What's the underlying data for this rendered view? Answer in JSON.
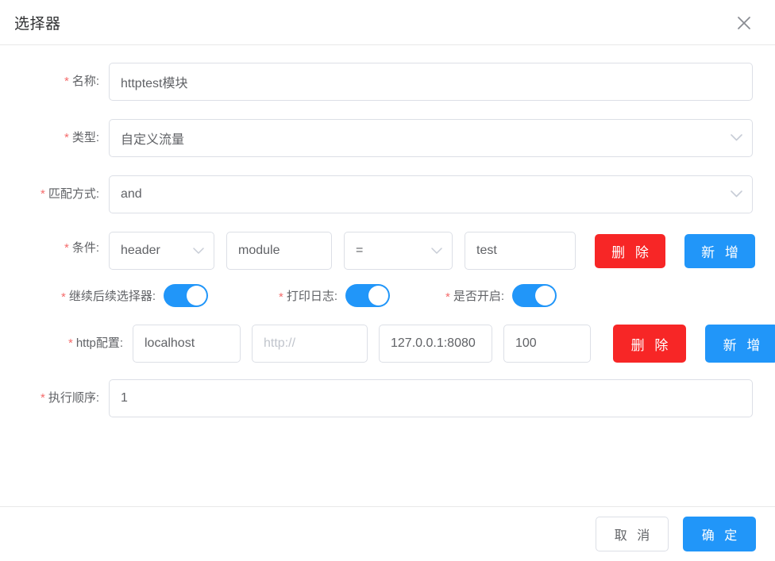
{
  "dialog": {
    "title": "选择器",
    "close_icon": "close-icon"
  },
  "form": {
    "name": {
      "label": "名称:",
      "required_marker": "*",
      "value": "httptest模块"
    },
    "type": {
      "label": "类型:",
      "required_marker": "*",
      "value": "自定义流量",
      "chevron_icon": "chevron-down-icon"
    },
    "match_mode": {
      "label": "匹配方式:",
      "required_marker": "*",
      "value": "and",
      "chevron_icon": "chevron-down-icon"
    },
    "condition": {
      "label": "条件:",
      "required_marker": "*",
      "field_source": "header",
      "field_key": "module",
      "operator": "=",
      "field_value": "test",
      "delete_label": "删 除",
      "add_label": "新 增"
    },
    "switches": [
      {
        "label": "继续后续选择器:",
        "required_marker": "*",
        "state": "on"
      },
      {
        "label": "打印日志:",
        "required_marker": "*",
        "state": "on"
      },
      {
        "label": "是否开启:",
        "required_marker": "*",
        "state": "on"
      }
    ],
    "http_config": {
      "label": "http配置:",
      "required_marker": "*",
      "host": "localhost",
      "protocol_placeholder": "http://",
      "protocol_value": "",
      "address": "127.0.0.1:8080",
      "weight": "100",
      "delete_label": "删 除",
      "add_label": "新 增"
    },
    "exec_order": {
      "label": "执行顺序:",
      "required_marker": "*",
      "value": "1"
    }
  },
  "footer": {
    "cancel_label": "取 消",
    "confirm_label": "确 定"
  },
  "colors": {
    "primary": "#2196f9",
    "danger": "#f72626",
    "required": "#f56c6c",
    "border": "#dcdfe6",
    "text": "#606266",
    "placeholder": "#c0c4cc"
  }
}
